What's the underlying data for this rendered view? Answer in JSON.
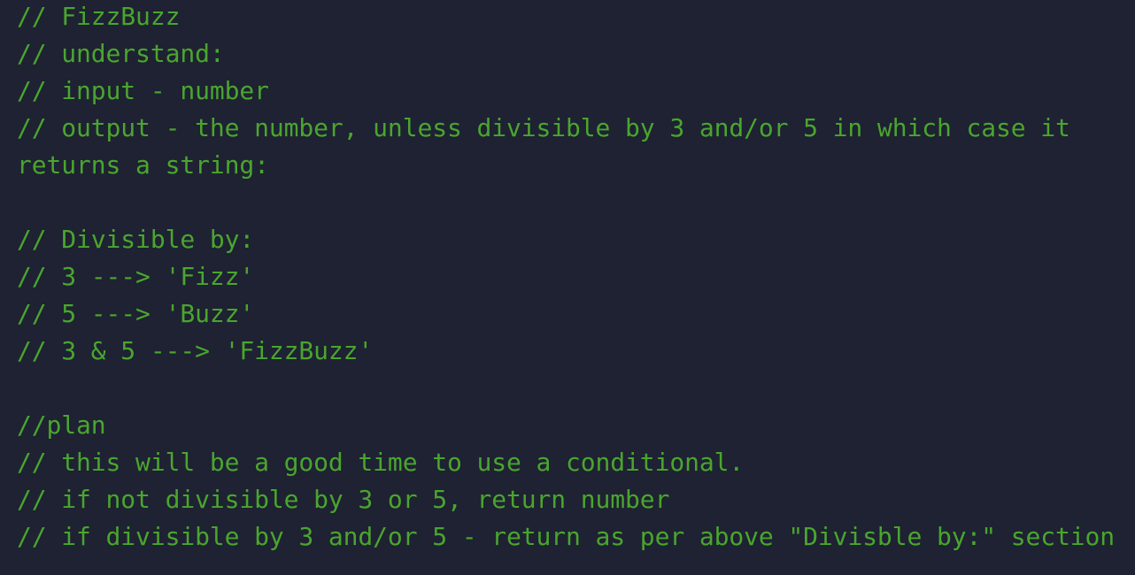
{
  "editor": {
    "text_color": "#4aa52e",
    "background_color": "#1e2232",
    "lines": [
      "// FizzBuzz",
      "// understand:",
      "// input - number",
      "// output - the number, unless divisible by 3 and/or 5 in which case it",
      "returns a string:",
      "",
      "// Divisible by:",
      "// 3 ---> 'Fizz'",
      "// 5 ---> 'Buzz'",
      "// 3 & 5 ---> 'FizzBuzz'",
      "",
      "//plan",
      "// this will be a good time to use a conditional.",
      "// if not divisible by 3 or 5, return number",
      "// if divisible by 3 and/or 5 - return as per above \"Divisble by:\" section"
    ]
  }
}
